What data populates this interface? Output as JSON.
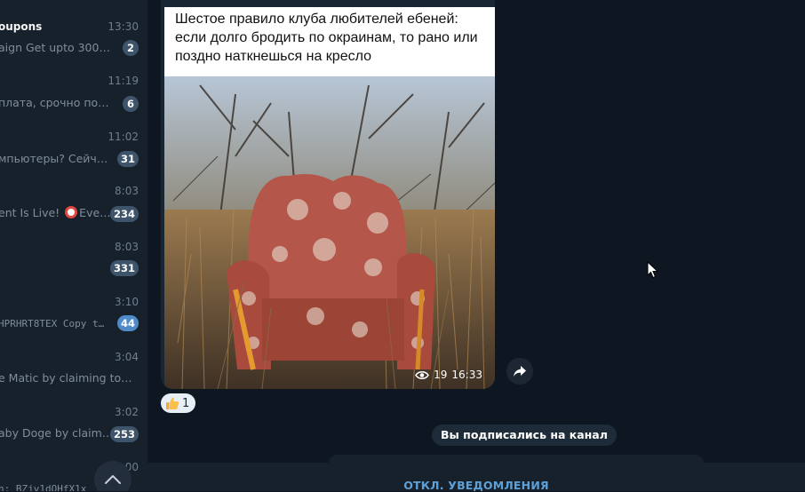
{
  "sidebar": {
    "chats": [
      {
        "title": "oupons",
        "time": "13:30",
        "preview": "aign Get upto 30000…",
        "badge": "2",
        "unmuted": false
      },
      {
        "title": "",
        "time": "11:19",
        "preview": "плата, срочно под…",
        "badge": "6",
        "unmuted": false
      },
      {
        "title": "",
        "time": "11:02",
        "preview": "мпьютеры?  Сейча…",
        "badge": "31",
        "unmuted": false
      },
      {
        "title": "",
        "time": "8:03",
        "preview_a": "ent Is Live! ",
        "preview_b": "Eve…",
        "badge": "234",
        "unmuted": false
      },
      {
        "title": "",
        "time": "8:03",
        "preview": "",
        "badge": "331",
        "unmuted": false
      },
      {
        "title": "",
        "time": "3:10",
        "preview": "HPRHRT8TEX  Copy t…",
        "badge": "44",
        "unmuted": true
      },
      {
        "title": "",
        "time": "3:04",
        "preview": "e Matic by claiming toda…",
        "badge": "",
        "unmuted": false
      },
      {
        "title": "",
        "time": "3:02",
        "preview": "aby Doge by claimi…",
        "badge": "253",
        "unmuted": false
      },
      {
        "title": "",
        "time": "00",
        "preview": "n: BZjv1dOHfX1x",
        "badge": "",
        "unmuted": false
      }
    ],
    "scroll_up_icon": "chevron-up-icon"
  },
  "post": {
    "caption_lines": [
      "Шестое правило клуба любителей ебеней:",
      "если долго бродить по окраинам, то рано или",
      "поздно наткнешься на кресло"
    ],
    "views": "19",
    "time": "16:33"
  },
  "reaction": {
    "emoji_icon": "thumbs-up-icon",
    "count": "1"
  },
  "service_message": "Вы подписались на канал",
  "compose": {
    "mute_label": "ОТКЛ. УВЕДОМЛЕНИЯ"
  },
  "colors": {
    "accent": "#5ea1d8",
    "badge_muted": "#3e546a",
    "badge_unmuted": "#4f8bc9",
    "background": "#0e1621"
  }
}
